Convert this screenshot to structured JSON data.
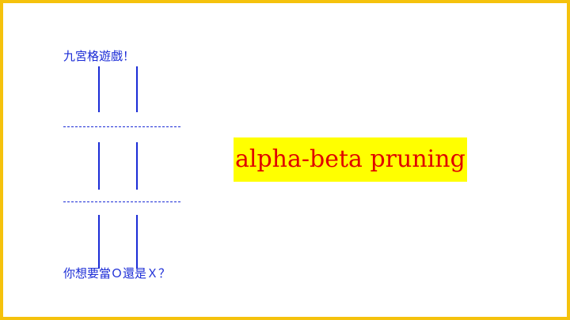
{
  "slide": {
    "console": {
      "title": "九宮格遊戲！",
      "prompt": "你想要當Ｏ還是Ｘ？",
      "text_color": "#1a2bd6"
    },
    "heading": {
      "text": "alpha-beta pruning",
      "text_color": "#e00000",
      "highlight_color": "#ffff00"
    },
    "border_color": "#f5c20c"
  }
}
